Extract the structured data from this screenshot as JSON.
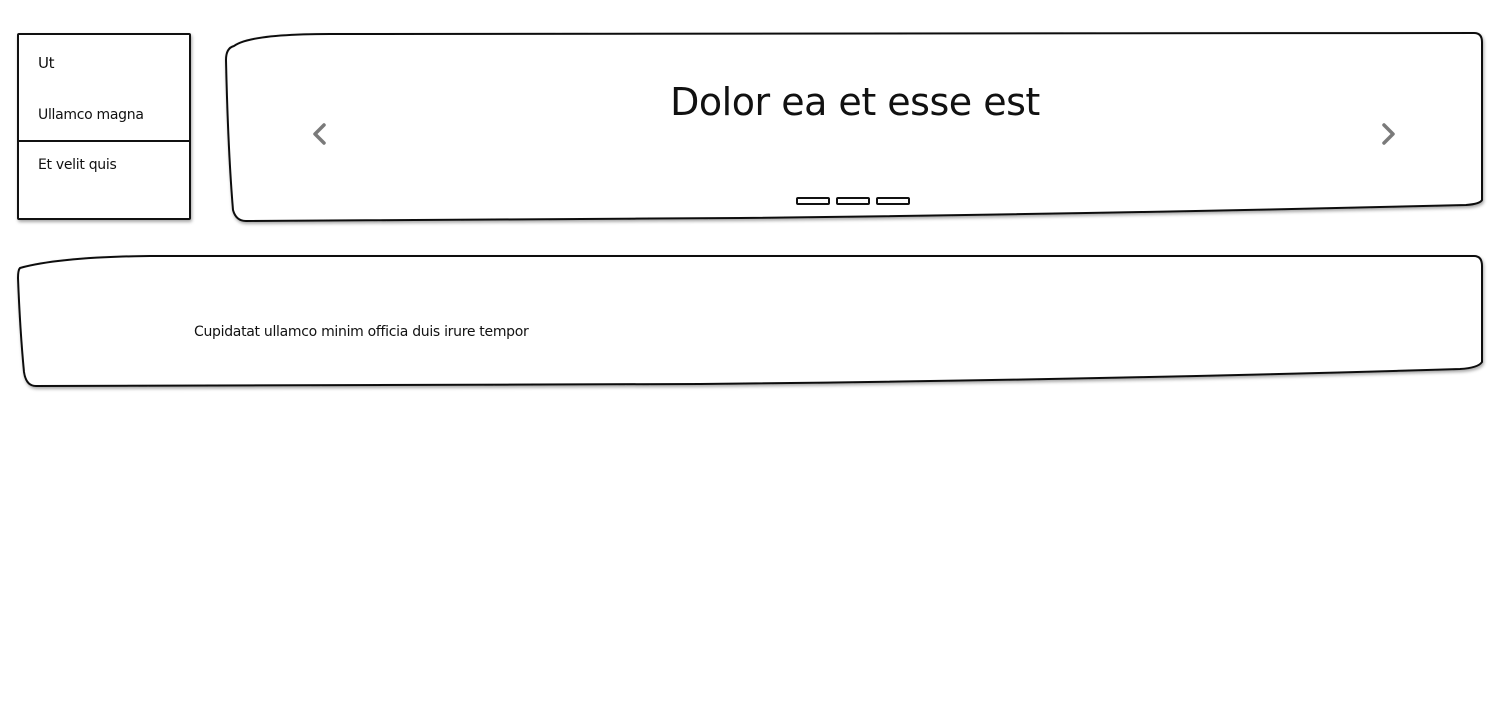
{
  "sidebar": {
    "items": [
      {
        "label": "Ut"
      },
      {
        "label": "Ullamco magna"
      },
      {
        "label": "Et velit quis"
      }
    ]
  },
  "carousel": {
    "title": "Dolor ea et esse est",
    "prev_icon": "chevron-left-icon",
    "next_icon": "chevron-right-icon",
    "slide_count": 3
  },
  "panel": {
    "text": "Cupidatat ullamco minim officia duis irure tempor"
  }
}
